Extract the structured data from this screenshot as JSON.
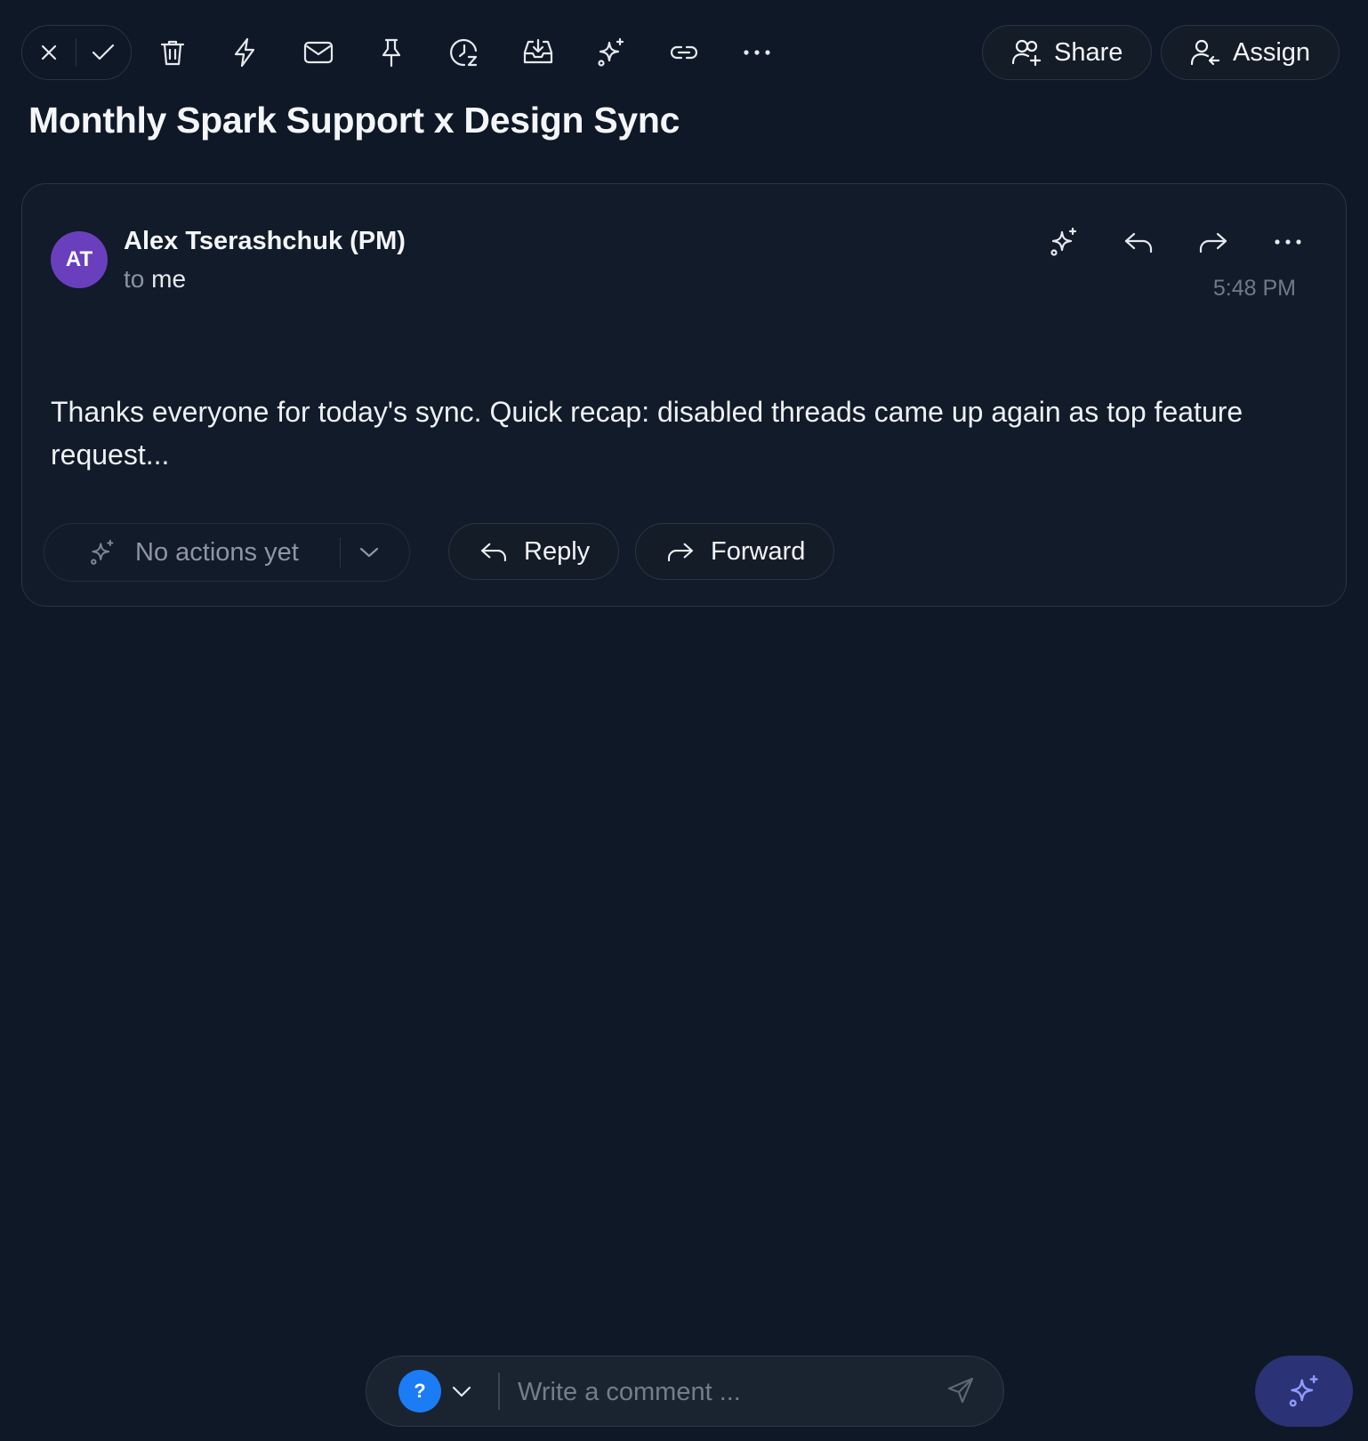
{
  "toolbar": {
    "icons": [
      "close-icon",
      "check-icon",
      "trash-icon",
      "bolt-icon",
      "envelope-icon",
      "pin-icon",
      "snooze-clock-icon",
      "archive-tray-icon",
      "sparkle-icon",
      "link-icon",
      "more-horizontal-icon"
    ],
    "share_label": "Share",
    "assign_label": "Assign"
  },
  "thread": {
    "title": "Monthly Spark Support x Design Sync"
  },
  "message": {
    "avatar_initials": "AT",
    "avatar_color": "#6a3fbd",
    "sender": "Alex Tserashchuk (PM)",
    "to_prefix": "to",
    "to_value": "me",
    "time": "5:48 PM",
    "body": "Thanks everyone for today's sync. Quick recap: disabled threads came up again as top feature request...",
    "header_icons": [
      "sparkle-icon",
      "reply-icon",
      "forward-icon",
      "more-horizontal-icon"
    ],
    "ai_actions_label": "No actions yet",
    "reply_label": "Reply",
    "forward_label": "Forward"
  },
  "comment": {
    "help_badge": "?",
    "placeholder": "Write a comment ...",
    "help_color": "#1b7cf5"
  },
  "colors": {
    "background": "#0f1826",
    "card": "#111b29",
    "border": "#2a3444",
    "ai_fab": "#2b3275"
  }
}
